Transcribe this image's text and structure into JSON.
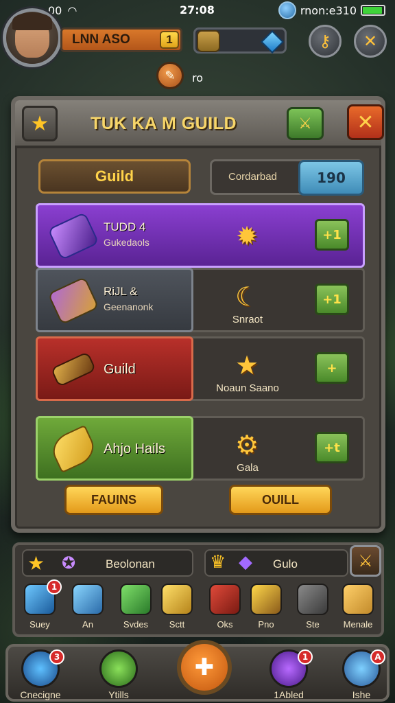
{
  "status": {
    "time": "27:08",
    "carrier": "00",
    "right_text": "rnon:e310"
  },
  "hud": {
    "player_name": "LNN ASO",
    "level": "1",
    "quest_label": "ro"
  },
  "panel": {
    "title": "TUK KA M GUILD",
    "guild_tab": "Guild",
    "contribution_label": "Cordarbad",
    "contribution_value": "190"
  },
  "rows": [
    {
      "title": "TUDD 4",
      "subtitle": "Gukedaols",
      "mid_label": "",
      "claim": "+1",
      "color": "#8a3fd0"
    },
    {
      "title": "RiJL &",
      "subtitle": "Geenanonk",
      "mid_label": "Snraot",
      "claim": "+1",
      "color": "#4f545c"
    },
    {
      "title": "Guild",
      "subtitle": "",
      "mid_label": "Noaun Saano",
      "claim": "+",
      "color": "#b8302a"
    },
    {
      "title": "Ahjo Hails",
      "subtitle": "",
      "mid_label": "Gala",
      "claim": "+t",
      "color": "#6fa93a"
    }
  ],
  "buttons": {
    "left": "FAUINS",
    "right": "OUILL"
  },
  "lower": {
    "left_label": "Beolonan",
    "right_label": "Gulo",
    "slots": [
      {
        "label": "Suey",
        "badge": "1"
      },
      {
        "label": "An",
        "badge": ""
      },
      {
        "label": "Svdes",
        "badge": ""
      },
      {
        "label": "Sctt",
        "badge": ""
      },
      {
        "label": "Oks",
        "badge": ""
      },
      {
        "label": "Pno",
        "badge": ""
      },
      {
        "label": "Ste",
        "badge": ""
      },
      {
        "label": "Menale",
        "badge": ""
      }
    ]
  },
  "nav": [
    {
      "label": "Cnecigne",
      "badge": "3"
    },
    {
      "label": "Ytills",
      "badge": ""
    },
    {
      "label": "",
      "badge": ""
    },
    {
      "label": "1Abled",
      "badge": "1"
    },
    {
      "label": "Ishe",
      "badge": "A"
    }
  ]
}
